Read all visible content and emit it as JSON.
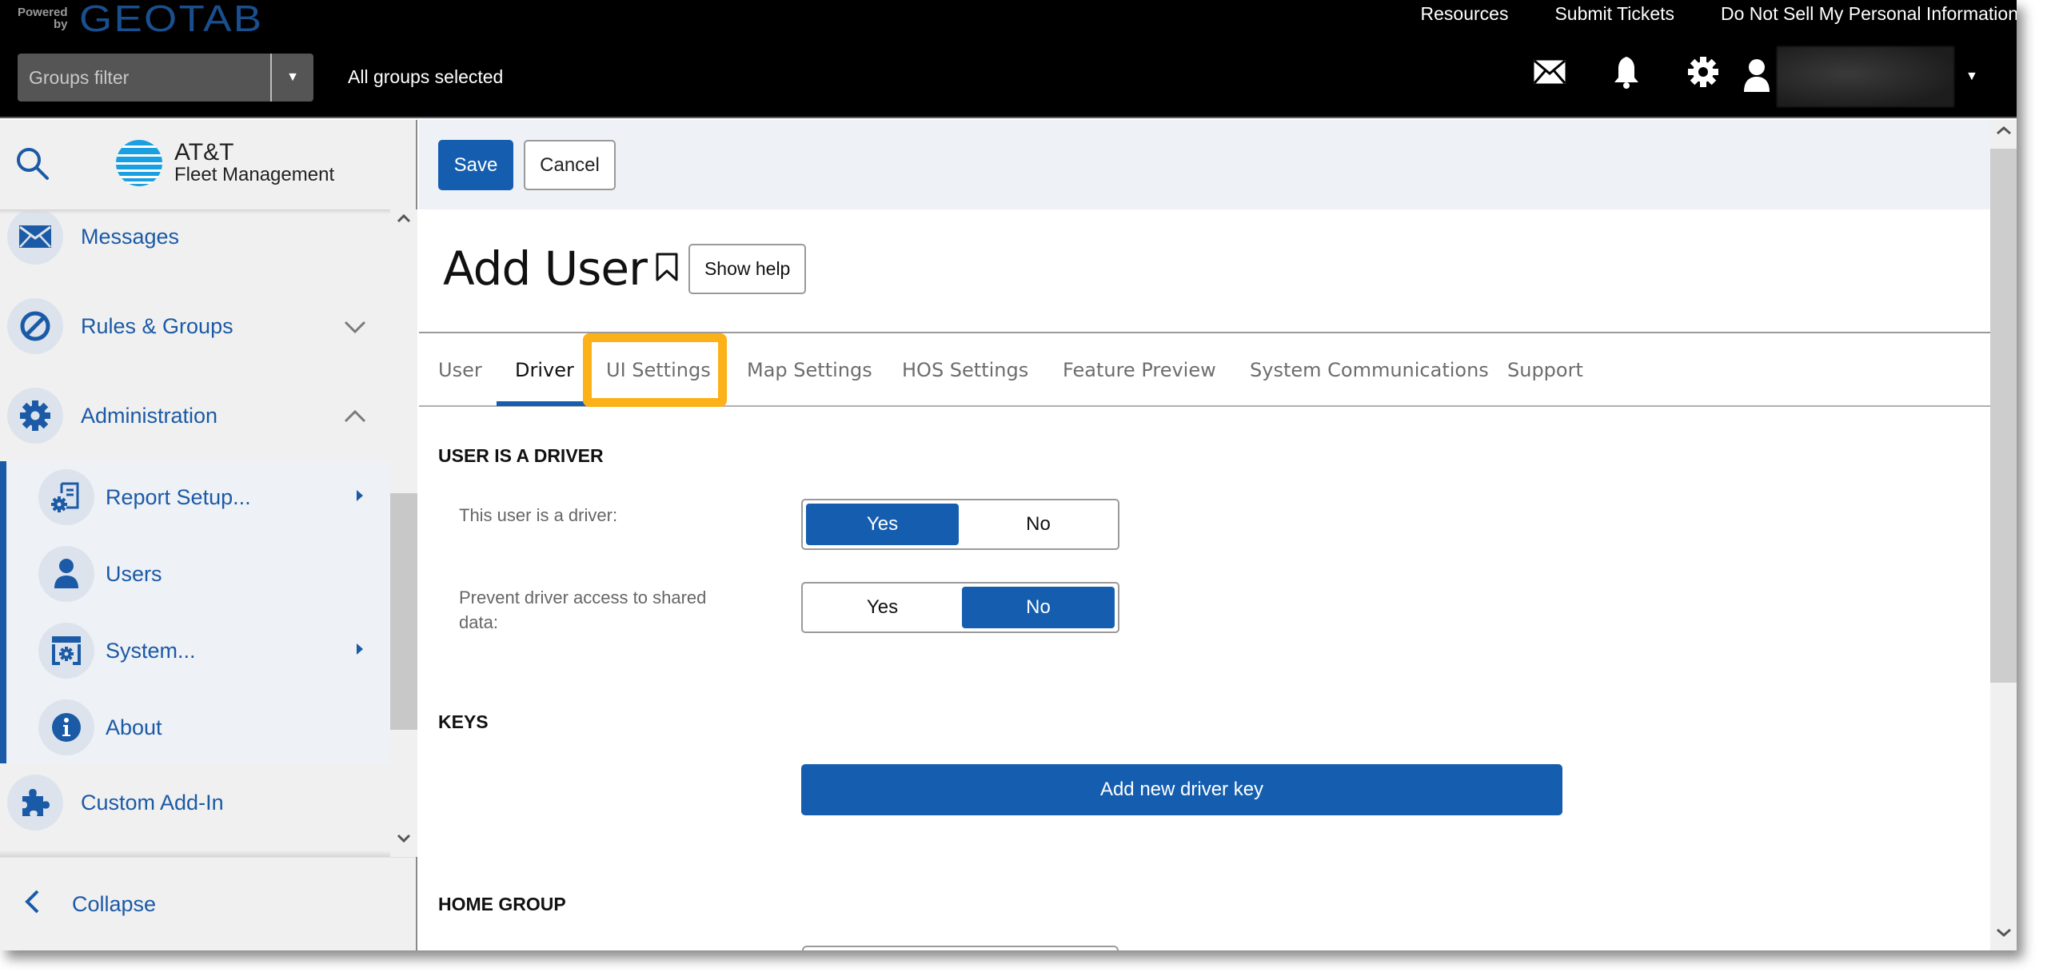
{
  "topbar": {
    "powered_by": "Powered by",
    "brand": "GEOTAB",
    "links": [
      "Resources",
      "Submit Tickets",
      "Do Not Sell My Personal Information"
    ],
    "groups_filter_placeholder": "Groups filter",
    "groups_status": "All groups selected",
    "icons": [
      "mail-icon",
      "bell-icon",
      "gear-icon",
      "user-icon"
    ]
  },
  "sidebar": {
    "logo_line1": "AT&T",
    "logo_line2": "Fleet Management",
    "items": [
      {
        "label": "Messages",
        "icon": "envelope-icon"
      },
      {
        "label": "Rules & Groups",
        "icon": "rules-icon",
        "expanded": false
      },
      {
        "label": "Administration",
        "icon": "gear-icon",
        "expanded": true
      },
      {
        "label": "Custom Add-In",
        "icon": "puzzle-icon"
      }
    ],
    "subitems": [
      {
        "label": "Report Setup...",
        "icon": "report-setup-icon",
        "has_submenu": true
      },
      {
        "label": "Users",
        "icon": "user-icon",
        "has_submenu": false
      },
      {
        "label": "System...",
        "icon": "system-icon",
        "has_submenu": true
      },
      {
        "label": "About",
        "icon": "info-icon",
        "has_submenu": false
      }
    ],
    "collapse_label": "Collapse"
  },
  "toolbar": {
    "save_label": "Save",
    "cancel_label": "Cancel"
  },
  "page": {
    "title": "Add User",
    "show_help_label": "Show help"
  },
  "tabs": {
    "items": [
      "User",
      "Driver",
      "UI Settings",
      "Map Settings",
      "HOS Settings",
      "Feature Preview",
      "System Communications",
      "Support"
    ],
    "active": "Driver",
    "highlighted": "UI Settings"
  },
  "driver": {
    "section_title": "USER IS A DRIVER",
    "is_driver_label": "This user is a driver:",
    "is_driver_value": "Yes",
    "prevent_access_label": "Prevent driver access to shared data:",
    "prevent_access_value": "No",
    "yes_label": "Yes",
    "no_label": "No"
  },
  "keys": {
    "section_title": "KEYS",
    "add_key_label": "Add new driver key"
  },
  "home_group": {
    "section_title": "HOME GROUP"
  },
  "colors": {
    "accent": "#155EAF",
    "highlight": "#FBB117",
    "topbar": "#000000",
    "sidebar_bg": "#F0F0F0"
  }
}
